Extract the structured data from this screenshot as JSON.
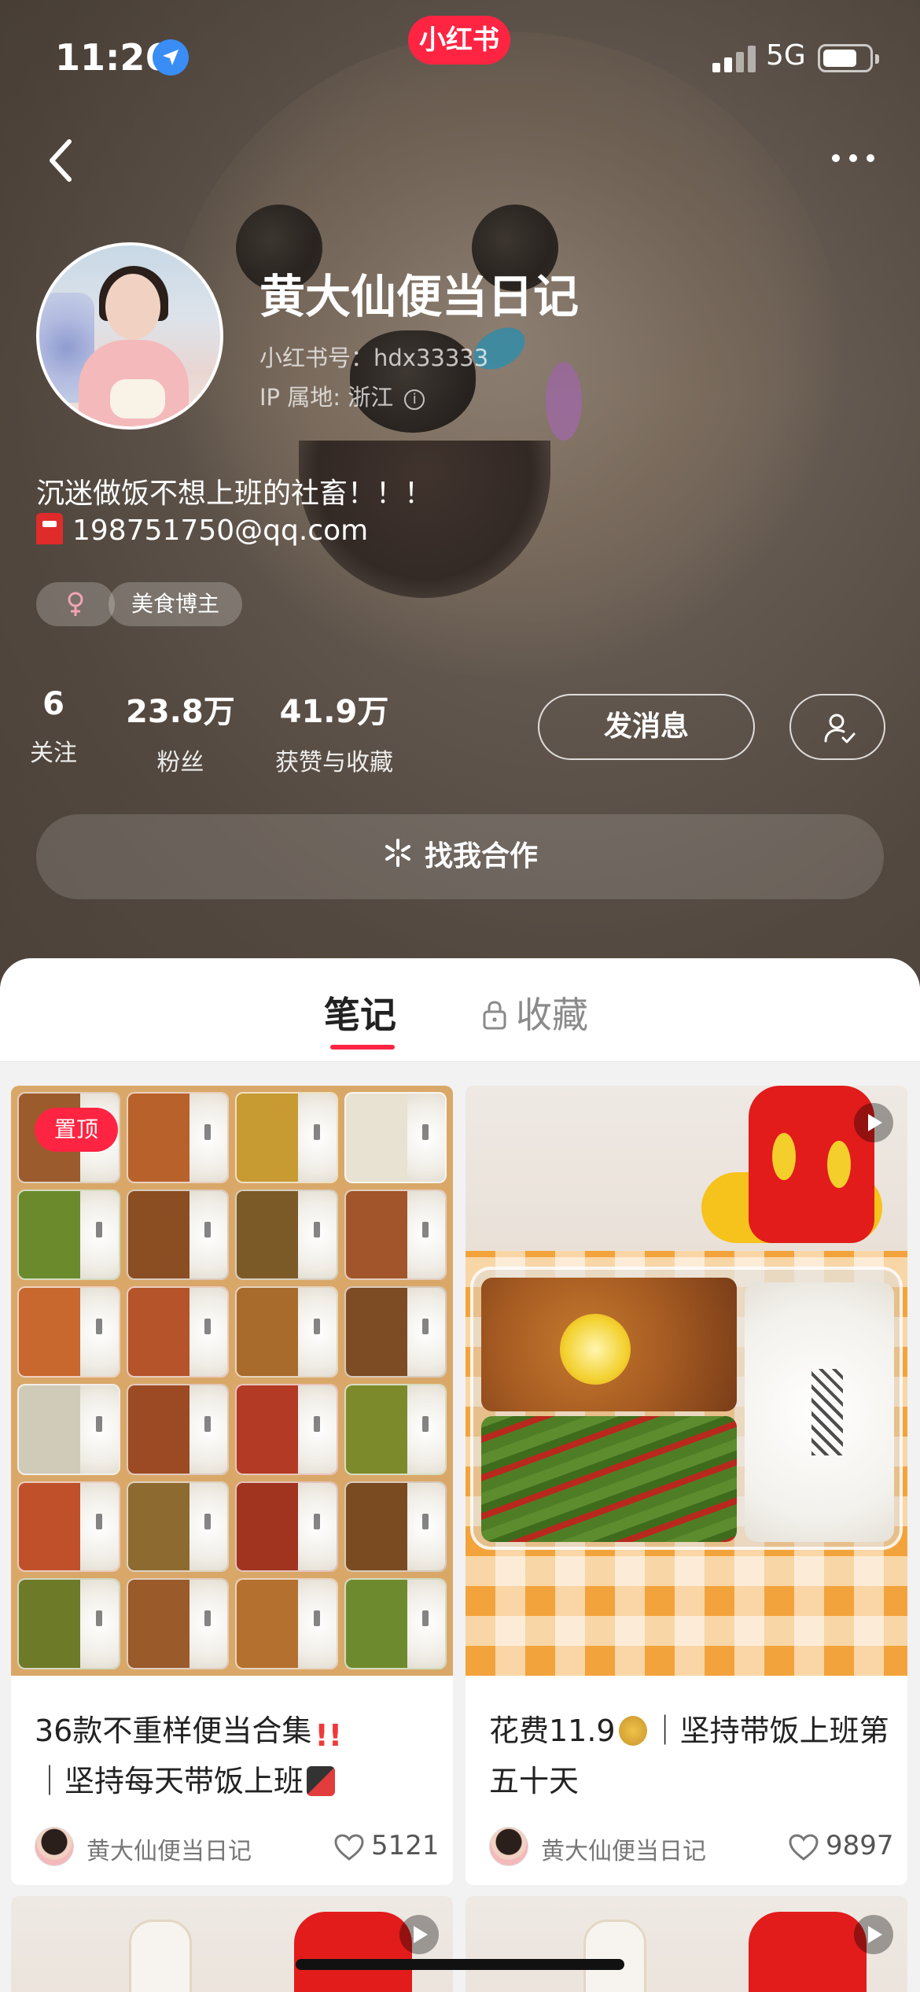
{
  "status_bar": {
    "time": "11:26",
    "app_badge": "小红书",
    "network": "5G"
  },
  "profile": {
    "nickname": "黄大仙便当日记",
    "red_id": "小红书号：hdx33333",
    "ip_location": "IP 属地: 浙江",
    "bio_line1": "沉迷做饭不想上班的社畜！！！",
    "bio_line2": "198751750@qq.com",
    "tags": {
      "gender_icon": "female-icon",
      "category": "美食博主"
    },
    "stats": {
      "following": {
        "value": "6",
        "label": "关注"
      },
      "fans": {
        "value": "23.8万",
        "label": "粉丝"
      },
      "likes": {
        "value": "41.9万",
        "label": "获赞与收藏"
      }
    },
    "message_button": "发消息",
    "cooperate_button": "找我合作"
  },
  "tabs": {
    "notes": "笔记",
    "favorites": "收藏"
  },
  "notes": [
    {
      "pinned_label": "置顶",
      "title_part1": "36款不重样便当合集",
      "title_part2": "｜坚持每天带饭上班",
      "author": "黄大仙便当日记",
      "likes": "5121"
    },
    {
      "title_part1": "花费11.9",
      "title_part2": "｜坚持带饭上班第五十天",
      "author": "黄大仙便当日记",
      "likes": "9897"
    }
  ],
  "colors": {
    "brand_red": "#ff2442",
    "location_blue": "#3a8df5"
  }
}
